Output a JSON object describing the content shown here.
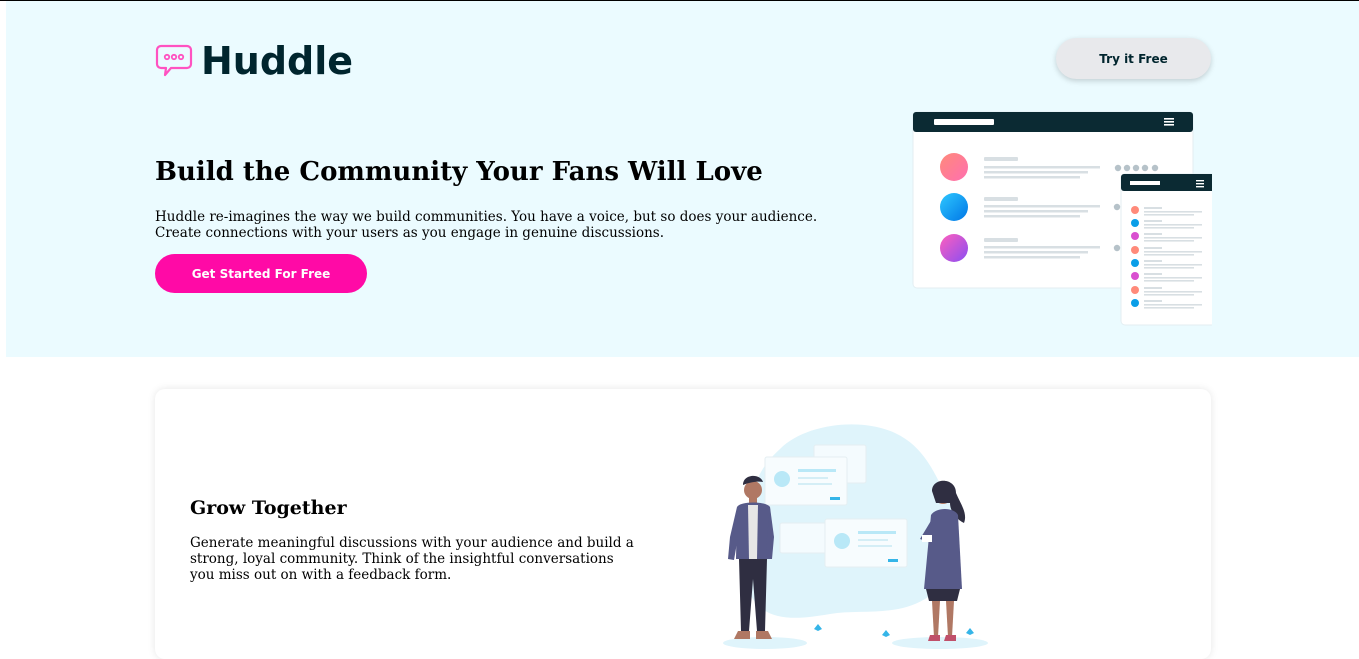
{
  "brand": {
    "name": "Huddle"
  },
  "header": {
    "try_label": "Try it Free"
  },
  "hero": {
    "title": "Build the Community Your Fans Will Love",
    "description": "Huddle re-imagines the way we build communities. You have a voice, but so does your audience. Create connections with your users as you engage in genuine discussions.",
    "cta_label": "Get Started For Free"
  },
  "features": [
    {
      "title": "Grow Together",
      "description": "Generate meaningful discussions with your audience and build a strong, loyal community. Think of the insightful conversations you miss out on with a feedback form."
    }
  ],
  "colors": {
    "hero_background": "#ebfbff",
    "brand_dark": "#00252e",
    "accent_pink": "#ff0aa6"
  },
  "icons": {
    "logo": "speech-bubble-icon"
  }
}
